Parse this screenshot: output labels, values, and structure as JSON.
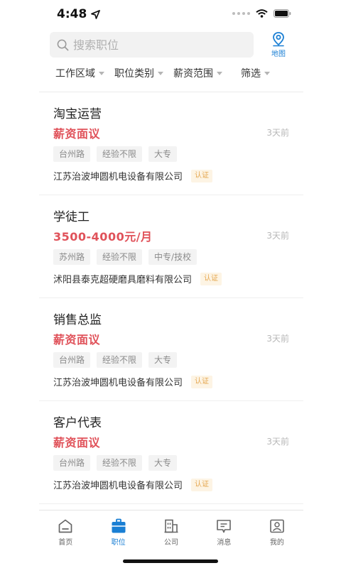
{
  "status_bar": {
    "time": "4:48",
    "icons": [
      "location-arrow-icon",
      "signal-icon",
      "wifi-icon",
      "battery-icon"
    ]
  },
  "search": {
    "placeholder": "搜索职位",
    "value": "",
    "icon": "search-icon"
  },
  "map_button": {
    "label": "地图",
    "icon": "map-pin-icon"
  },
  "filters": [
    {
      "label": "工作区域"
    },
    {
      "label": "职位类别"
    },
    {
      "label": "薪资范围"
    },
    {
      "label": "筛选"
    }
  ],
  "jobs": [
    {
      "title": "淘宝运营",
      "salary": "薪资面议",
      "date": "3天前",
      "tags": [
        "台州路",
        "经验不限",
        "大专"
      ],
      "company": "江苏治波坤圆机电设备有限公司",
      "badge": "认证"
    },
    {
      "title": "学徒工",
      "salary": "3500-4000元/月",
      "date": "3天前",
      "tags": [
        "苏州路",
        "经验不限",
        "中专/技校"
      ],
      "company": "沭阳县泰克超硬磨具磨料有限公司",
      "badge": "认证"
    },
    {
      "title": "销售总监",
      "salary": "薪资面议",
      "date": "3天前",
      "tags": [
        "台州路",
        "经验不限",
        "大专"
      ],
      "company": "江苏治波坤圆机电设备有限公司",
      "badge": "认证"
    },
    {
      "title": "客户代表",
      "salary": "薪资面议",
      "date": "3天前",
      "tags": [
        "台州路",
        "经验不限",
        "大专"
      ],
      "company": "江苏治波坤圆机电设备有限公司",
      "badge": "认证"
    }
  ],
  "tabs": [
    {
      "label": "首页",
      "icon": "home-icon",
      "active": false
    },
    {
      "label": "职位",
      "icon": "briefcase-icon",
      "active": true
    },
    {
      "label": "公司",
      "icon": "building-icon",
      "active": false
    },
    {
      "label": "消息",
      "icon": "message-icon",
      "active": false
    },
    {
      "label": "我的",
      "icon": "profile-icon",
      "active": false
    }
  ],
  "colors": {
    "accent": "#1a7fd4",
    "salary": "#e0525a",
    "badge_text": "#e5a750",
    "badge_bg": "#fdf4e4",
    "tag_bg": "#f3f3f3"
  }
}
